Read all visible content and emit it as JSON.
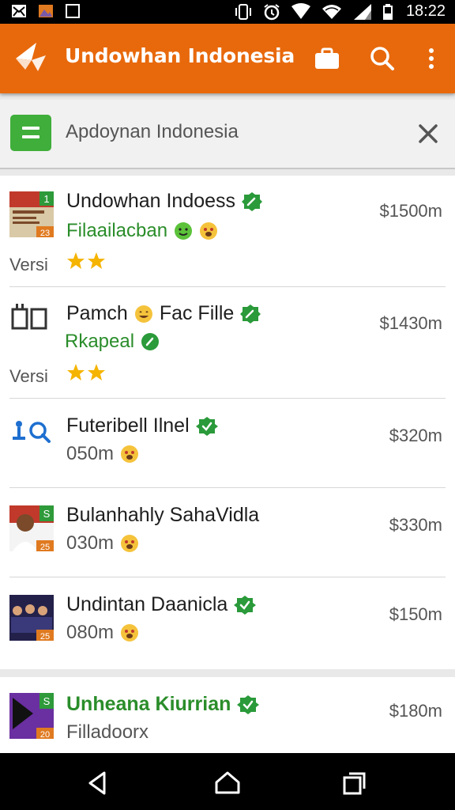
{
  "status_bar": {
    "time": "18:22",
    "left_icons": [
      "mail-icon",
      "gallery-icon",
      "screen-icon"
    ],
    "right_icons": [
      "vibrate-icon",
      "alarm-icon",
      "signal-icon",
      "wifi-icon",
      "cell-signal-icon",
      "battery-icon"
    ]
  },
  "app_bar": {
    "title": "Undowhan Indonesia",
    "color": "#e8690c",
    "actions": [
      "briefcase-icon",
      "search-icon",
      "overflow-menu-icon"
    ]
  },
  "filter": {
    "text": "Apdoynan Indonesia",
    "close_icon": "close-icon",
    "accent": "#3fae3a"
  },
  "items": [
    {
      "title": "Undowhan Indoess",
      "subtitle": "Filaailacban",
      "version": "Versi",
      "price": "$1500m",
      "stars": 2,
      "thumb_badge": "1",
      "thumb_label": "23"
    },
    {
      "title": "Pamch",
      "title_after": "Fac Fille",
      "subtitle": "Rkapeal",
      "version": "Versi",
      "price": "$1430m",
      "stars": 2
    },
    {
      "title": "Futeribell Ilnel",
      "subtitle": "050m",
      "price": "$320m"
    },
    {
      "title": "Bulanhahly SahaVidla",
      "subtitle": "030m",
      "price": "$330m",
      "thumb_badge": "S",
      "thumb_label": "25"
    },
    {
      "title": "Undintan Daanicla",
      "subtitle": "080m",
      "price": "$150m",
      "thumb_label": "25"
    },
    {
      "title": "Unheana Kiurrian",
      "subtitle": "Filladoorx",
      "price": "$180m",
      "thumb_badge": "S",
      "thumb_label": "20"
    }
  ],
  "nav_bar": [
    "back-icon",
    "home-icon",
    "recents-icon"
  ],
  "colors": {
    "verified": "#2a9a3a",
    "star": "#f5b400",
    "accent_green": "#2a8d2a"
  }
}
